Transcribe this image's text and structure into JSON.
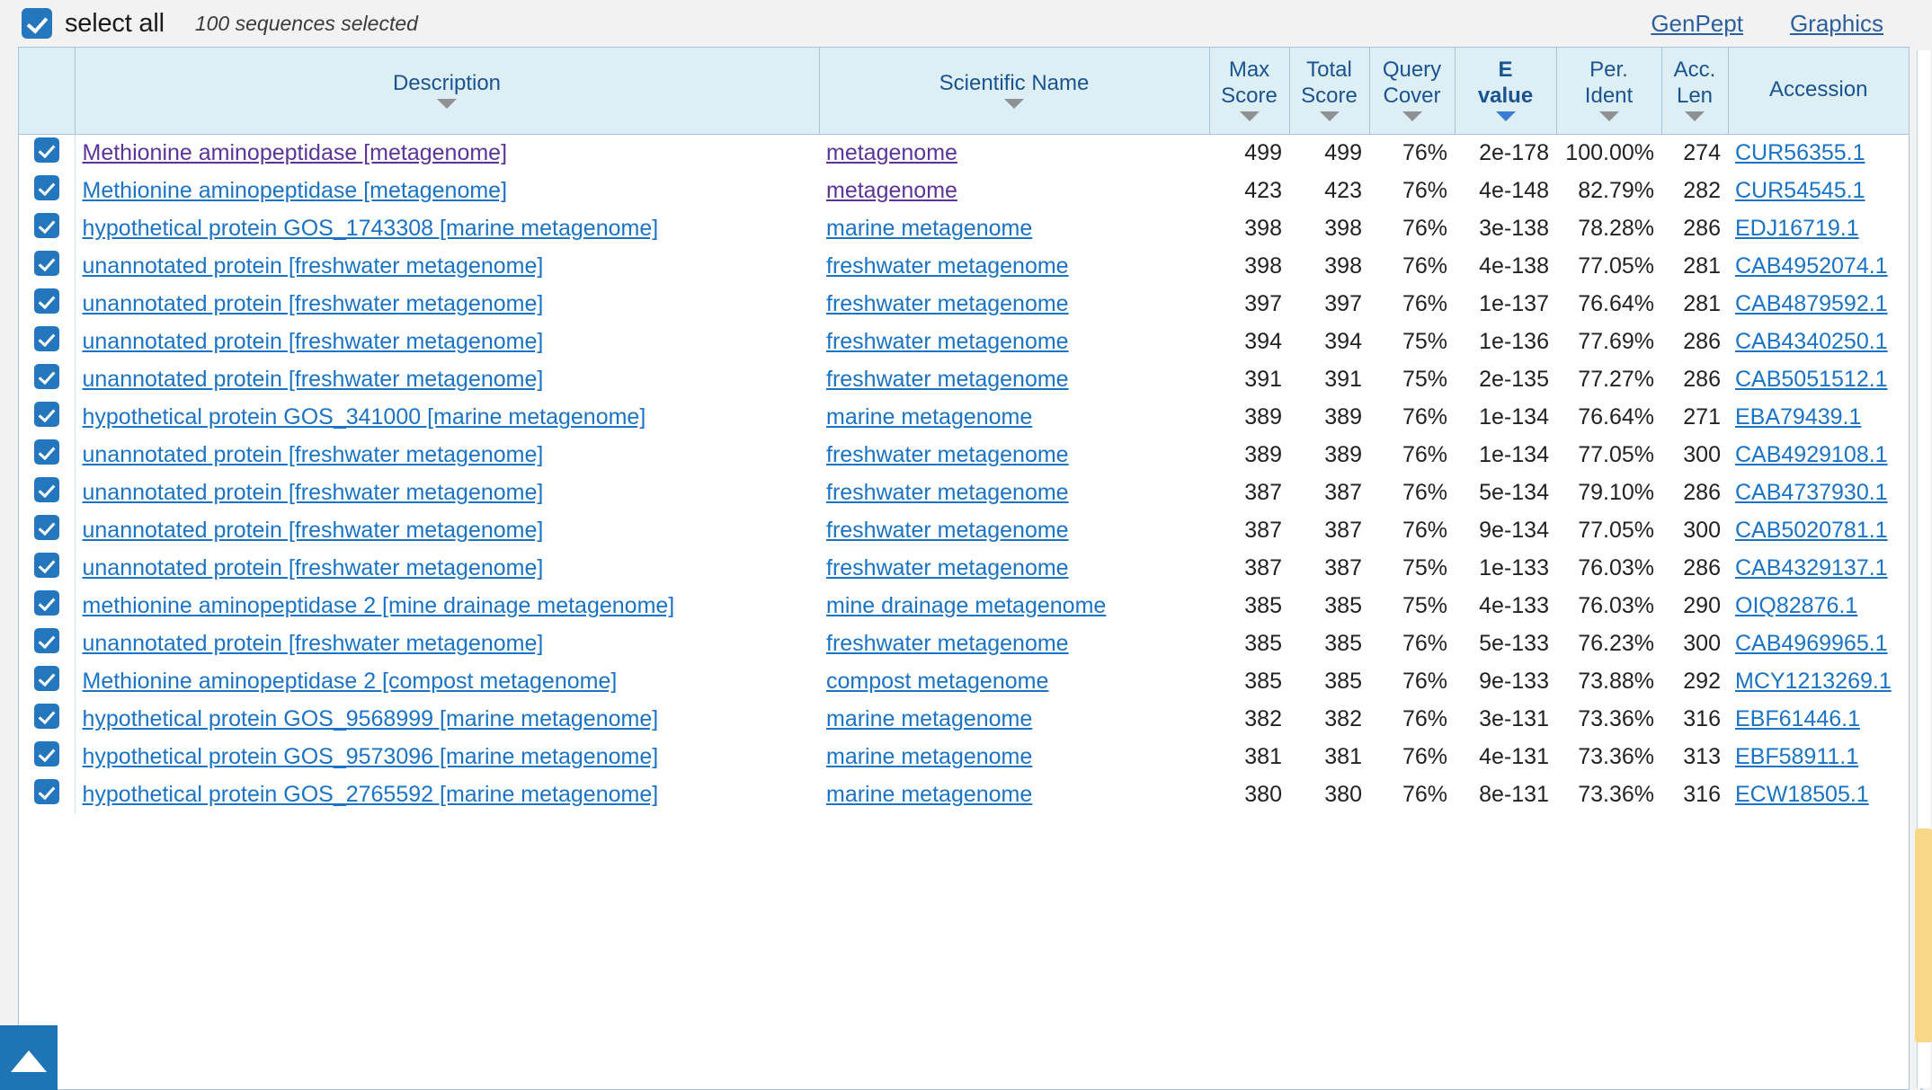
{
  "toolbar": {
    "select_all_label": "select all",
    "selected_count": "100 sequences selected",
    "genpept_label": "GenPept",
    "graphics_label": "Graphics"
  },
  "table": {
    "headers": {
      "description": "Description",
      "scientific_name": "Scientific Name",
      "max_score_line1": "Max",
      "max_score_line2": "Score",
      "total_score_line1": "Total",
      "total_score_line2": "Score",
      "query_cover_line1": "Query",
      "query_cover_line2": "Cover",
      "e_value_line1": "E",
      "e_value_line2": "value",
      "per_ident_line1": "Per.",
      "per_ident_line2": "Ident",
      "acc_len_line1": "Acc.",
      "acc_len_line2": "Len",
      "accession": "Accession"
    },
    "sorted_column": "e_value",
    "rows": [
      {
        "checked": true,
        "description": "Methionine aminopeptidase [metagenome]",
        "description_visited": true,
        "scientific_name": "metagenome",
        "scientific_visited": true,
        "max_score": "499",
        "total_score": "499",
        "query_cover": "76%",
        "e_value": "2e-178",
        "per_ident": "100.00%",
        "acc_len": "274",
        "accession": "CUR56355.1"
      },
      {
        "checked": true,
        "description": "Methionine aminopeptidase [metagenome]",
        "description_visited": false,
        "scientific_name": "metagenome",
        "scientific_visited": true,
        "max_score": "423",
        "total_score": "423",
        "query_cover": "76%",
        "e_value": "4e-148",
        "per_ident": "82.79%",
        "acc_len": "282",
        "accession": "CUR54545.1"
      },
      {
        "checked": true,
        "description": "hypothetical protein GOS_1743308 [marine metagenome]",
        "description_visited": false,
        "scientific_name": "marine metagenome",
        "scientific_visited": false,
        "max_score": "398",
        "total_score": "398",
        "query_cover": "76%",
        "e_value": "3e-138",
        "per_ident": "78.28%",
        "acc_len": "286",
        "accession": "EDJ16719.1"
      },
      {
        "checked": true,
        "description": "unannotated protein [freshwater metagenome]",
        "description_visited": false,
        "scientific_name": "freshwater metagenome",
        "scientific_visited": false,
        "max_score": "398",
        "total_score": "398",
        "query_cover": "76%",
        "e_value": "4e-138",
        "per_ident": "77.05%",
        "acc_len": "281",
        "accession": "CAB4952074.1"
      },
      {
        "checked": true,
        "description": "unannotated protein [freshwater metagenome]",
        "description_visited": false,
        "scientific_name": "freshwater metagenome",
        "scientific_visited": false,
        "max_score": "397",
        "total_score": "397",
        "query_cover": "76%",
        "e_value": "1e-137",
        "per_ident": "76.64%",
        "acc_len": "281",
        "accession": "CAB4879592.1"
      },
      {
        "checked": true,
        "description": "unannotated protein [freshwater metagenome]",
        "description_visited": false,
        "scientific_name": "freshwater metagenome",
        "scientific_visited": false,
        "max_score": "394",
        "total_score": "394",
        "query_cover": "75%",
        "e_value": "1e-136",
        "per_ident": "77.69%",
        "acc_len": "286",
        "accession": "CAB4340250.1"
      },
      {
        "checked": true,
        "description": "unannotated protein [freshwater metagenome]",
        "description_visited": false,
        "scientific_name": "freshwater metagenome",
        "scientific_visited": false,
        "max_score": "391",
        "total_score": "391",
        "query_cover": "75%",
        "e_value": "2e-135",
        "per_ident": "77.27%",
        "acc_len": "286",
        "accession": "CAB5051512.1"
      },
      {
        "checked": true,
        "description": "hypothetical protein GOS_341000 [marine metagenome]",
        "description_visited": false,
        "scientific_name": "marine metagenome",
        "scientific_visited": false,
        "max_score": "389",
        "total_score": "389",
        "query_cover": "76%",
        "e_value": "1e-134",
        "per_ident": "76.64%",
        "acc_len": "271",
        "accession": "EBA79439.1"
      },
      {
        "checked": true,
        "description": "unannotated protein [freshwater metagenome]",
        "description_visited": false,
        "scientific_name": "freshwater metagenome",
        "scientific_visited": false,
        "max_score": "389",
        "total_score": "389",
        "query_cover": "76%",
        "e_value": "1e-134",
        "per_ident": "77.05%",
        "acc_len": "300",
        "accession": "CAB4929108.1"
      },
      {
        "checked": true,
        "description": "unannotated protein [freshwater metagenome]",
        "description_visited": false,
        "scientific_name": "freshwater metagenome",
        "scientific_visited": false,
        "max_score": "387",
        "total_score": "387",
        "query_cover": "76%",
        "e_value": "5e-134",
        "per_ident": "79.10%",
        "acc_len": "286",
        "accession": "CAB4737930.1"
      },
      {
        "checked": true,
        "description": "unannotated protein [freshwater metagenome]",
        "description_visited": false,
        "scientific_name": "freshwater metagenome",
        "scientific_visited": false,
        "max_score": "387",
        "total_score": "387",
        "query_cover": "76%",
        "e_value": "9e-134",
        "per_ident": "77.05%",
        "acc_len": "300",
        "accession": "CAB5020781.1"
      },
      {
        "checked": true,
        "description": "unannotated protein [freshwater metagenome]",
        "description_visited": false,
        "scientific_name": "freshwater metagenome",
        "scientific_visited": false,
        "max_score": "387",
        "total_score": "387",
        "query_cover": "75%",
        "e_value": "1e-133",
        "per_ident": "76.03%",
        "acc_len": "286",
        "accession": "CAB4329137.1"
      },
      {
        "checked": true,
        "description": "methionine aminopeptidase 2 [mine drainage metagenome]",
        "description_visited": false,
        "scientific_name": "mine drainage metagenome",
        "scientific_visited": false,
        "max_score": "385",
        "total_score": "385",
        "query_cover": "75%",
        "e_value": "4e-133",
        "per_ident": "76.03%",
        "acc_len": "290",
        "accession": "OIQ82876.1"
      },
      {
        "checked": true,
        "description": "unannotated protein [freshwater metagenome]",
        "description_visited": false,
        "scientific_name": "freshwater metagenome",
        "scientific_visited": false,
        "max_score": "385",
        "total_score": "385",
        "query_cover": "76%",
        "e_value": "5e-133",
        "per_ident": "76.23%",
        "acc_len": "300",
        "accession": "CAB4969965.1"
      },
      {
        "checked": true,
        "description": "Methionine aminopeptidase 2 [compost metagenome]",
        "description_visited": false,
        "scientific_name": "compost metagenome",
        "scientific_visited": false,
        "max_score": "385",
        "total_score": "385",
        "query_cover": "76%",
        "e_value": "9e-133",
        "per_ident": "73.88%",
        "acc_len": "292",
        "accession": "MCY1213269.1"
      },
      {
        "checked": true,
        "description": "hypothetical protein GOS_9568999 [marine metagenome]",
        "description_visited": false,
        "scientific_name": "marine metagenome",
        "scientific_visited": false,
        "max_score": "382",
        "total_score": "382",
        "query_cover": "76%",
        "e_value": "3e-131",
        "per_ident": "73.36%",
        "acc_len": "316",
        "accession": "EBF61446.1"
      },
      {
        "checked": true,
        "description": "hypothetical protein GOS_9573096 [marine metagenome]",
        "description_visited": false,
        "scientific_name": "marine metagenome",
        "scientific_visited": false,
        "max_score": "381",
        "total_score": "381",
        "query_cover": "76%",
        "e_value": "4e-131",
        "per_ident": "73.36%",
        "acc_len": "313",
        "accession": "EBF58911.1"
      },
      {
        "checked": true,
        "description": "hypothetical protein GOS_2765592 [marine metagenome]",
        "description_visited": false,
        "scientific_name": "marine metagenome",
        "scientific_visited": false,
        "max_score": "380",
        "total_score": "380",
        "query_cover": "76%",
        "e_value": "8e-131",
        "per_ident": "73.36%",
        "acc_len": "316",
        "accession": "ECW18505.1"
      }
    ]
  },
  "controls": {
    "back_to_top_label": "back to top",
    "scrollbar_label": "vertical scrollbar"
  },
  "colors": {
    "accent": "#2477bd",
    "header_bg": "#ddeef4",
    "link": "#1a73c4",
    "link_visited": "#5b3499",
    "toolbar_link": "#2c5f9e",
    "scroll_thumb": "#f8d787",
    "sort_active": "#3a7dd0"
  }
}
